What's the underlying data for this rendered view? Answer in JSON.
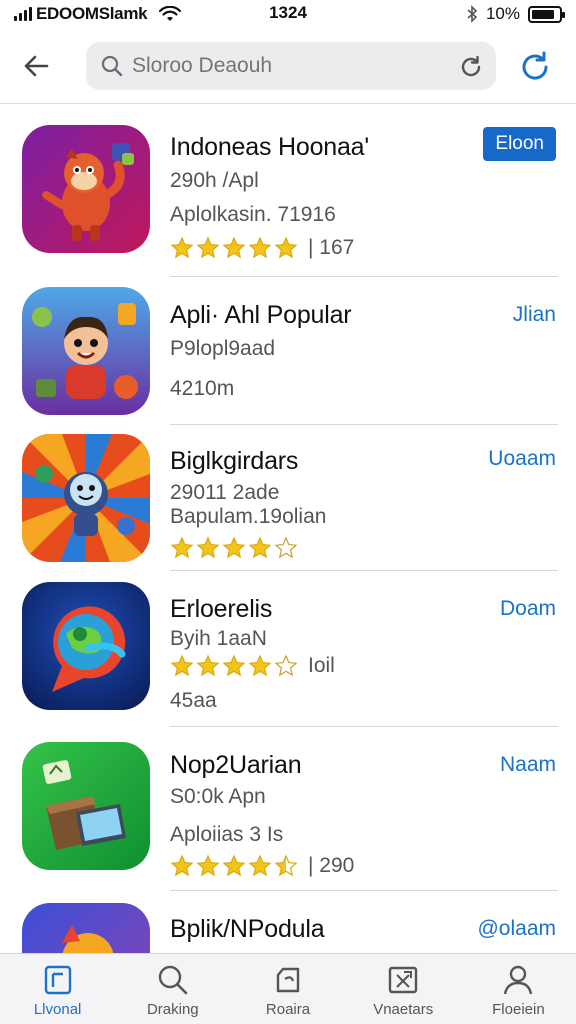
{
  "status_bar": {
    "carrier": "EDOOMSlamk",
    "time": "1324",
    "battery_text": "10%",
    "battery_level": 0.85
  },
  "header": {
    "search_placeholder": "Sloroo Deaouh",
    "back_icon": "back-arrow-icon",
    "refresh_icon": "refresh-icon"
  },
  "apps": [
    {
      "name": "Indoneas Hoonaa'",
      "line1": "290h /Apl",
      "line2": "Aplolkasin. 71916",
      "stars": 5,
      "rating_count": "| 167",
      "button": "Eloon",
      "button_style": "primary"
    },
    {
      "name": "Apli· Ahl Popular",
      "line1": "P9lopl9aad",
      "line2": "4210m",
      "stars": 0,
      "rating_count": "",
      "button": "Jlian",
      "button_style": "link"
    },
    {
      "name": "Biglkgirdars",
      "line1": "29011 2ade",
      "line2": "Bapulam.19olian",
      "stars": 4,
      "rating_count": "",
      "button": "Uoaam",
      "button_style": "link"
    },
    {
      "name": "Erloerelis",
      "line1": "Byih 1aaN",
      "line2": "45aa",
      "stars": 4,
      "rating_count": "Ioil",
      "button": "Doam",
      "button_style": "link"
    },
    {
      "name": "Nop2Uarian",
      "line1": "S0:0k Apn",
      "line2": "Aploiias 3 Is",
      "stars": 4.5,
      "rating_count": "| 290",
      "button": "Naam",
      "button_style": "link"
    },
    {
      "name": "Bplik/NPodula",
      "line1": "",
      "line2": "",
      "stars": 0,
      "rating_count": "",
      "button": "@olaam",
      "button_style": "link"
    }
  ],
  "tabs": [
    {
      "label": "Llvonal",
      "icon": "today-icon",
      "active": true
    },
    {
      "label": "Draking",
      "icon": "search-icon",
      "active": false
    },
    {
      "label": "Roaira",
      "icon": "apps-icon",
      "active": false
    },
    {
      "label": "Vnaetars",
      "icon": "updates-icon",
      "active": false
    },
    {
      "label": "Floeiein",
      "icon": "profile-icon",
      "active": false
    }
  ],
  "colors": {
    "accent": "#1a73c8",
    "primary_button": "#1769c9",
    "star": "#f3c41a",
    "tab_bar": "#f4f4f6"
  }
}
